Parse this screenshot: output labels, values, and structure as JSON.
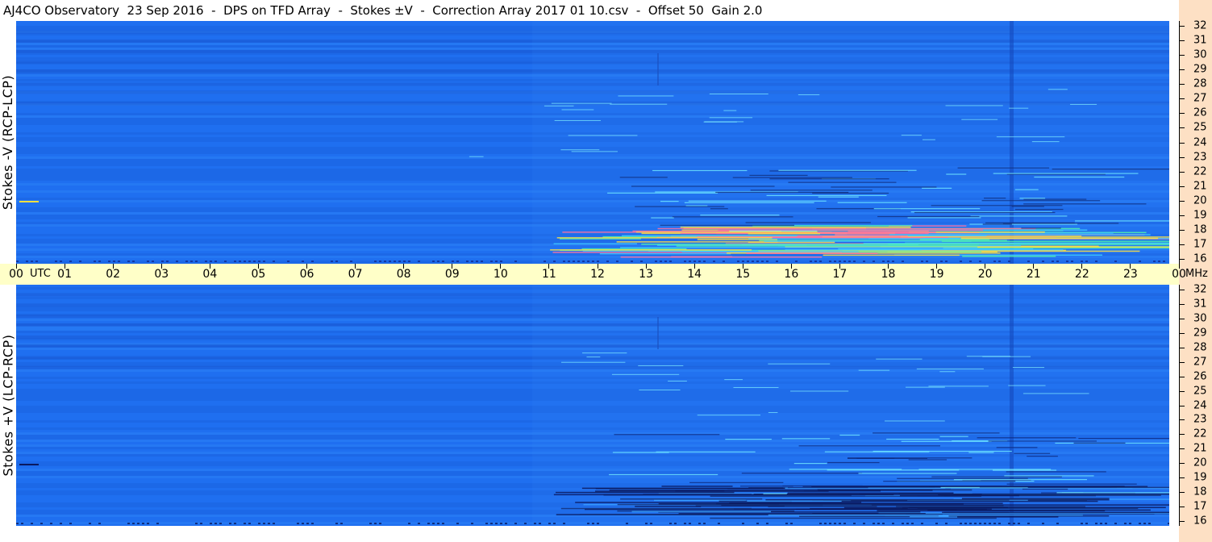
{
  "title": "AJ4CO Observatory  23 Sep 2016  -  DPS on TFD Array  -  Stokes ±V  -  Correction Array 2017 01 10.csv  -  Offset 50  Gain 2.0",
  "panels": {
    "top_label": "Stokes -V (RCP-LCP)",
    "bottom_label": "Stokes +V (LCP-RCP)"
  },
  "time_axis": {
    "utc_label": "UTC",
    "hours": [
      "00",
      "01",
      "02",
      "03",
      "04",
      "05",
      "06",
      "07",
      "08",
      "09",
      "10",
      "11",
      "12",
      "13",
      "14",
      "15",
      "16",
      "17",
      "18",
      "19",
      "20",
      "21",
      "22",
      "23",
      "00"
    ],
    "unit": "MHz"
  },
  "frequency_axis": {
    "labels": [
      "32",
      "31",
      "30",
      "29",
      "28",
      "27",
      "26",
      "25",
      "24",
      "23",
      "22",
      "21",
      "20",
      "19",
      "18",
      "17",
      "16"
    ]
  },
  "colors": {
    "background_blue": "#1e6ff0",
    "axis_band": "#ffffc8",
    "side_strip": "#fde0c4"
  }
}
